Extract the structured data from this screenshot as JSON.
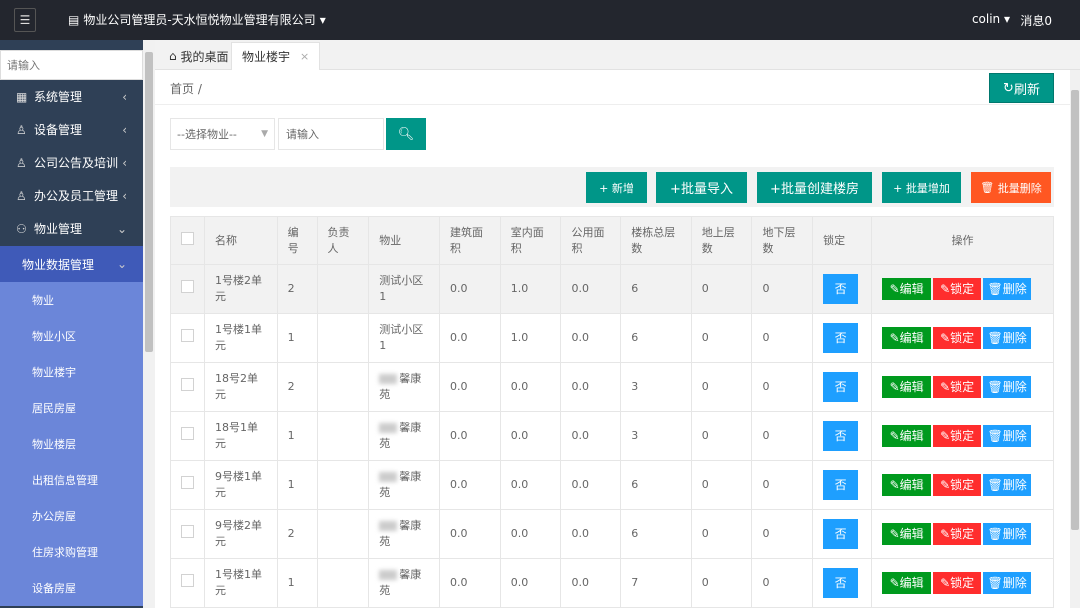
{
  "header": {
    "title": "物业公司管理员-天水恒悦物业管理有限公司",
    "user": "colin",
    "messages": "消息0"
  },
  "sidebar": {
    "search_placeholder": "请输入",
    "items": [
      {
        "label": "系统管理",
        "icon": "grid-icon"
      },
      {
        "label": "设备管理",
        "icon": "user-icon"
      },
      {
        "label": "公司公告及培训",
        "icon": "user-icon"
      },
      {
        "label": "办公及员工管理",
        "icon": "user-icon"
      },
      {
        "label": "物业管理",
        "icon": "people-icon"
      }
    ],
    "active_group": "物业数据管理",
    "sub_items": [
      "物业",
      "物业小区",
      "物业楼宇",
      "居民房屋",
      "物业楼层",
      "出租信息管理",
      "办公房屋",
      "住房求购管理",
      "设备房屋"
    ]
  },
  "tabs": [
    {
      "label": "我的桌面"
    },
    {
      "label": "物业楼宇"
    }
  ],
  "breadcrumb": "首页  /",
  "refresh_label": "刷新",
  "filter": {
    "select_placeholder": "--选择物业--",
    "search_placeholder": "请输入"
  },
  "toolbar": {
    "add": "+ 新增",
    "batch_import": "+批量导入",
    "batch_create": "+批量创建楼房",
    "batch_add": "+ 批量增加",
    "batch_delete": "批量删除"
  },
  "table": {
    "headers": [
      "名称",
      "编号",
      "负责人",
      "物业",
      "建筑面积",
      "室内面积",
      "公用面积",
      "楼栋总层数",
      "地上层数",
      "地下层数",
      "锁定",
      "操作"
    ],
    "rows": [
      {
        "name": "1号楼2单元",
        "no": "2",
        "owner": "",
        "property": "测试小区1",
        "blur": false,
        "build": "0.0",
        "indoor": "1.0",
        "public": "0.0",
        "floors": "6",
        "above": "0",
        "below": "0",
        "lock": "否"
      },
      {
        "name": "1号楼1单元",
        "no": "1",
        "owner": "",
        "property": "测试小区1",
        "blur": false,
        "build": "0.0",
        "indoor": "1.0",
        "public": "0.0",
        "floors": "6",
        "above": "0",
        "below": "0",
        "lock": "否"
      },
      {
        "name": "18号2单元",
        "no": "2",
        "owner": "",
        "property": "馨康苑",
        "blur": true,
        "build": "0.0",
        "indoor": "0.0",
        "public": "0.0",
        "floors": "3",
        "above": "0",
        "below": "0",
        "lock": "否"
      },
      {
        "name": "18号1单元",
        "no": "1",
        "owner": "",
        "property": "馨康苑",
        "blur": true,
        "build": "0.0",
        "indoor": "0.0",
        "public": "0.0",
        "floors": "3",
        "above": "0",
        "below": "0",
        "lock": "否"
      },
      {
        "name": "9号楼1单元",
        "no": "1",
        "owner": "",
        "property": "馨康苑",
        "blur": true,
        "build": "0.0",
        "indoor": "0.0",
        "public": "0.0",
        "floors": "6",
        "above": "0",
        "below": "0",
        "lock": "否"
      },
      {
        "name": "9号楼2单元",
        "no": "2",
        "owner": "",
        "property": "馨康苑",
        "blur": true,
        "build": "0.0",
        "indoor": "0.0",
        "public": "0.0",
        "floors": "6",
        "above": "0",
        "below": "0",
        "lock": "否"
      },
      {
        "name": "1号楼1单元",
        "no": "1",
        "owner": "",
        "property": "馨康苑",
        "blur": true,
        "build": "0.0",
        "indoor": "0.0",
        "public": "0.0",
        "floors": "7",
        "above": "0",
        "below": "0",
        "lock": "否"
      }
    ],
    "ops": {
      "edit": "编辑",
      "lock": "锁定",
      "delete": "删除"
    }
  },
  "colors": {
    "teal": "#009688",
    "orange": "#ff5722",
    "blue": "#1e9fff",
    "green": "#009a1e",
    "red": "#ff2d2d",
    "sidebar": "#2f4056",
    "active": "#3f5ab8",
    "sub": "#6b86d9"
  }
}
